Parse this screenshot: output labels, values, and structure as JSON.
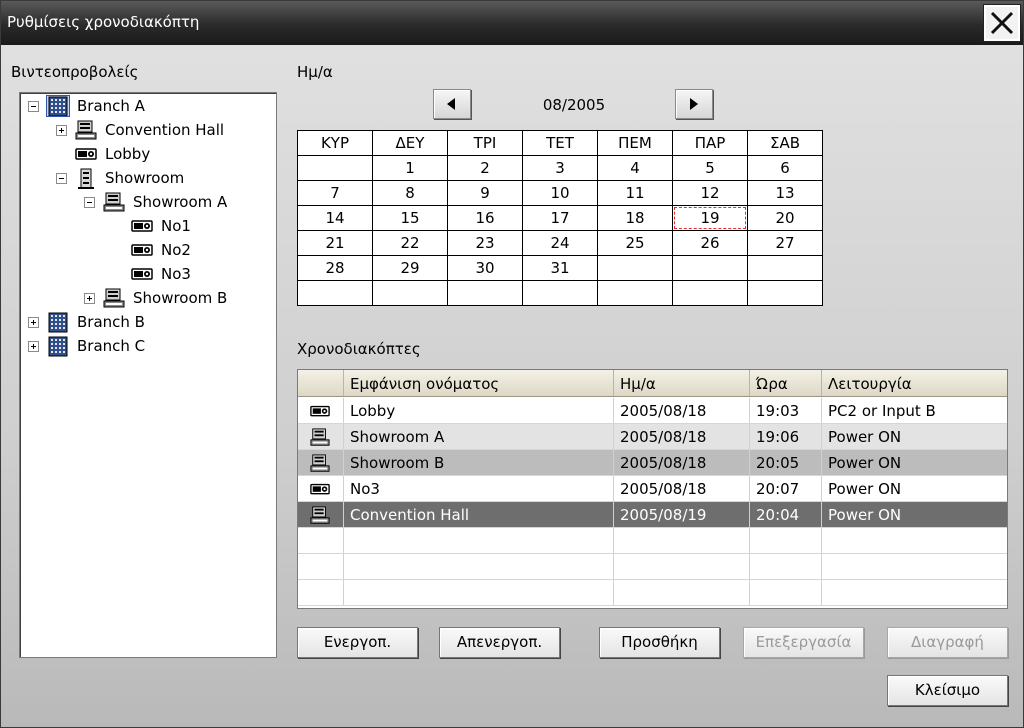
{
  "window": {
    "title": "Ρυθμίσεις χρονοδιακόπτη"
  },
  "labels": {
    "projectors": "Βιντεοπροβολείς",
    "date": "Ημ/α",
    "timers": "Χρονοδιακόπτες"
  },
  "tree": [
    {
      "label": "Branch A",
      "icon": "building-icon",
      "expander": "minus",
      "selected": true
    },
    {
      "label": "Convention Hall",
      "icon": "room-icon",
      "expander": "plus"
    },
    {
      "label": "Lobby",
      "icon": "projector-icon",
      "expander": "none"
    },
    {
      "label": "Showroom",
      "icon": "floor-icon",
      "expander": "minus"
    },
    {
      "label": "Showroom A",
      "icon": "room-icon",
      "expander": "minus"
    },
    {
      "label": "No1",
      "icon": "projector-icon",
      "expander": "none"
    },
    {
      "label": "No2",
      "icon": "projector-icon",
      "expander": "none"
    },
    {
      "label": "No3",
      "icon": "projector-icon",
      "expander": "none"
    },
    {
      "label": "Showroom B",
      "icon": "room-icon",
      "expander": "plus"
    },
    {
      "label": "Branch B",
      "icon": "building-icon",
      "expander": "plus"
    },
    {
      "label": "Branch C",
      "icon": "building-icon",
      "expander": "plus"
    }
  ],
  "calendar": {
    "month_label": "08/2005",
    "weekdays": [
      "ΚΥΡ",
      "ΔΕΥ",
      "ΤΡΙ",
      "ΤΕΤ",
      "ΠΕΜ",
      "ΠΑΡ",
      "ΣΑΒ"
    ],
    "weeks": [
      [
        "",
        "1",
        "2",
        "3",
        "4",
        "5",
        "6"
      ],
      [
        "7",
        "8",
        "9",
        "10",
        "11",
        "12",
        "13"
      ],
      [
        "14",
        "15",
        "16",
        "17",
        "18",
        "19",
        "20"
      ],
      [
        "21",
        "22",
        "23",
        "24",
        "25",
        "26",
        "27"
      ],
      [
        "28",
        "29",
        "30",
        "31",
        "",
        "",
        ""
      ],
      [
        "",
        "",
        "",
        "",
        "",
        "",
        ""
      ]
    ],
    "selected_day": "19"
  },
  "timers": {
    "columns": [
      "Εμφάνιση ονόματος",
      "Ημ/α",
      "Ώρα",
      "Λειτουργία"
    ],
    "rows": [
      {
        "icon": "projector-icon",
        "name": "Lobby",
        "date": "2005/08/18",
        "time": "19:03",
        "function": "PC2 or Input B",
        "bg": "#ffffff",
        "fg": "#000000"
      },
      {
        "icon": "room-icon",
        "name": "Showroom A",
        "date": "2005/08/18",
        "time": "19:06",
        "function": "Power ON",
        "bg": "#e3e3e3",
        "fg": "#000000"
      },
      {
        "icon": "room-icon",
        "name": "Showroom B",
        "date": "2005/08/18",
        "time": "20:05",
        "function": "Power ON",
        "bg": "#bcbcbc",
        "fg": "#000000"
      },
      {
        "icon": "projector-icon",
        "name": "No3",
        "date": "2005/08/18",
        "time": "20:07",
        "function": "Power ON",
        "bg": "#ffffff",
        "fg": "#000000"
      },
      {
        "icon": "room-icon",
        "name": "Convention Hall",
        "date": "2005/08/19",
        "time": "20:04",
        "function": "Power ON",
        "bg": "#6e6e6e",
        "fg": "#ffffff"
      }
    ],
    "empty_rows": 3
  },
  "buttons": {
    "enable": "Ενεργοπ.",
    "disable": "Απενεργοπ.",
    "add": "Προσθήκη",
    "edit": "Επεξεργασία",
    "delete": "Διαγραφή",
    "close": "Κλείσιμο"
  }
}
